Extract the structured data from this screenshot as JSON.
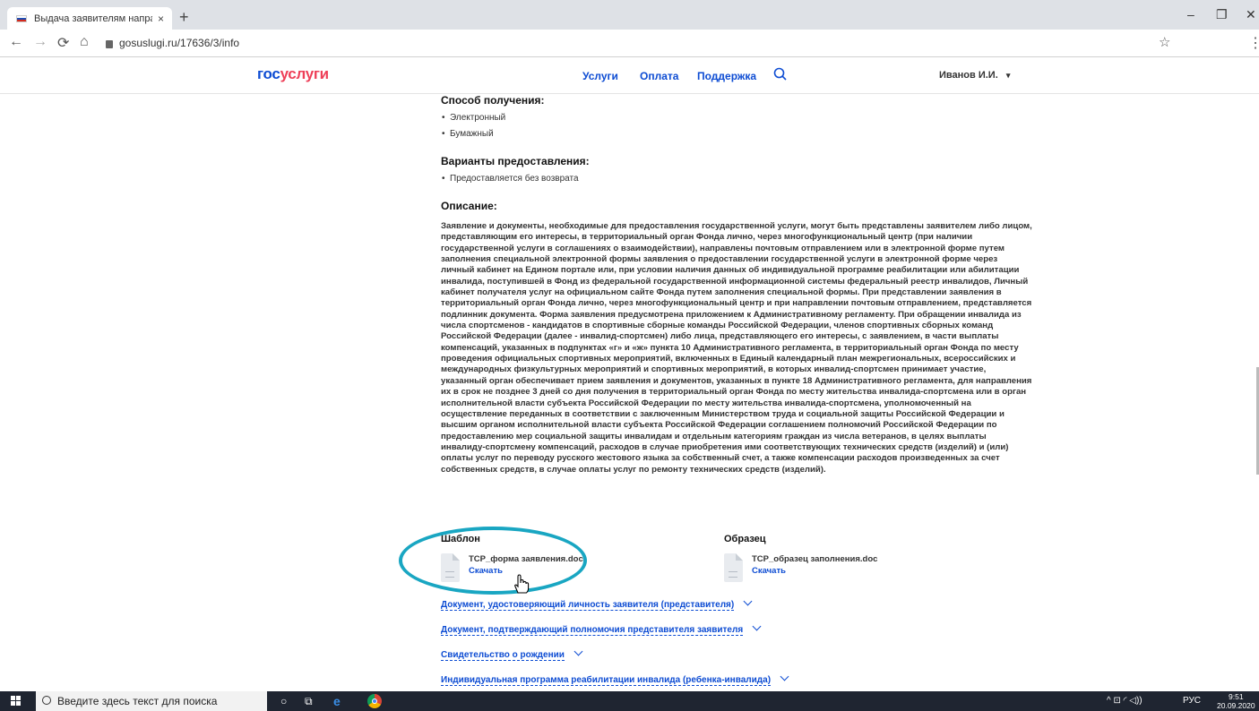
{
  "browser": {
    "tab_title": "Выдача заявителям направлени",
    "tab_close": "×",
    "new_tab": "+",
    "url": "gosuslugi.ru/17636/3/info",
    "controls": {
      "minimize": "–",
      "maximize": "❐",
      "close": "✕"
    },
    "nav_icons": {
      "back": "←",
      "forward": "→",
      "reload": "⟳",
      "home": "⌂",
      "star": "☆",
      "menu": "⋮"
    }
  },
  "header": {
    "logo_part1": "гос",
    "logo_part2": "услуги",
    "nav": [
      "Услуги",
      "Оплата",
      "Поддержка"
    ],
    "user": "Иванов И.И.",
    "user_caret": "▾"
  },
  "main": {
    "receipt_title": "Способ получения:",
    "receipt_items": [
      "Электронный",
      "Бумажный"
    ],
    "variants_title": "Варианты предоставления:",
    "variants_items": [
      "Предоставляется без возврата"
    ],
    "description_title": "Описание:",
    "description": "Заявление и документы, необходимые для предоставления государственной услуги, могут быть представлены заявителем либо лицом, представляющим его интересы, в территориальный орган Фонда лично, через многофункциональный центр (при наличии государственной услуги в соглашениях о взаимодействии), направлены почтовым отправлением или в электронной форме путем заполнения специальной электронной формы заявления о предоставлении государственной услуги в электронной форме через личный кабинет на Едином портале или, при условии наличия данных об индивидуальной программе реабилитации или абилитации инвалида, поступившей в Фонд из федеральной государственной информационной системы федеральный реестр инвалидов, Личный кабинет получателя услуг на официальном сайте Фонда путем заполнения специальной формы. При представлении заявления в территориальный орган Фонда лично, через многофункциональный центр и при направлении почтовым отправлением, представляется подлинник документа. Форма заявления предусмотрена приложением к Административному регламенту. При обращении инвалида из числа спортсменов - кандидатов в спортивные сборные команды Российской Федерации, членов спортивных сборных команд Российской Федерации (далее - инвалид-спортсмен) либо лица, представляющего его интересы, с заявлением, в части выплаты компенсаций, указанных в подпунктах «г» и «ж» пункта 10 Административного регламента, в территориальный орган Фонда по месту проведения официальных спортивных мероприятий, включенных в Единый календарный план межрегиональных, всероссийских и международных физкультурных мероприятий и спортивных мероприятий, в которых инвалид-спортсмен принимает участие, указанный орган обеспечивает прием заявления и документов, указанных в пункте 18 Административного регламента, для направления их в срок не позднее 3 дней со дня получения в территориальный орган Фонда по месту жительства инвалида-спортсмена или в орган исполнительной власти субъекта Российской Федерации по месту жительства инвалида-спортсмена, уполномоченный на осуществление переданных в соответствии с заключенным Министерством труда и социальной защиты Российской Федерации и высшим органом исполнительной власти субъекта Российской Федерации соглашением полномочий Российской Федерации по предоставлению мер социальной защиты инвалидам и отдельным категориям граждан из числа ветеранов, в целях выплаты инвалиду-спортсмену компенсаций, расходов в случае приобретения ими соответствующих технических средств (изделий) и (или) оплаты услуг по переводу русского жестового языка за собственный счет, а также компенсации расходов произведенных за счет собственных средств, в случае оплаты услуг по ремонту технических средств (изделий).",
    "template_title": "Шаблон",
    "template_file": "ТСР_форма заявления.doc",
    "template_download": "Скачать",
    "sample_title": "Образец",
    "sample_file": "ТСР_образец заполнения.doc",
    "sample_download": "Скачать",
    "accordion": [
      "Документ, удостоверяющий личность заявителя (представителя)",
      "Документ, подтверждающий полномочия представителя заявителя",
      "Свидетельство о рождении",
      "Индивидуальная программа реабилитации инвалида (ребенка-инвалида)"
    ]
  },
  "taskbar": {
    "search_placeholder": "Введите здесь текст для поиска",
    "tray_lang": "РУС",
    "time": "9:51",
    "date": "20.09.2020"
  },
  "colors": {
    "brand_blue": "#0d4cd3",
    "brand_red": "#ee3f58",
    "highlight_ring": "#19a6c2"
  }
}
